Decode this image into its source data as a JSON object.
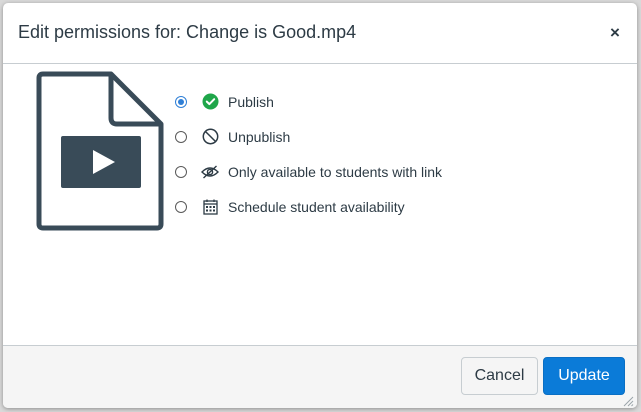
{
  "dialog": {
    "title": "Edit permissions for: Change is Good.mp4",
    "close_symbol": "×",
    "file_icon": "video-file-icon"
  },
  "options": [
    {
      "label": "Publish",
      "icon": "check-circle-icon",
      "checked": true
    },
    {
      "label": "Unpublish",
      "icon": "no-entry-icon",
      "checked": false
    },
    {
      "label": "Only available to students with link",
      "icon": "eye-slash-icon",
      "checked": false
    },
    {
      "label": "Schedule student availability",
      "icon": "calendar-icon",
      "checked": false
    }
  ],
  "footer": {
    "cancel_label": "Cancel",
    "update_label": "Update"
  },
  "colors": {
    "primary": "#0b7bd8",
    "success": "#1fa64a",
    "text": "#2d3b45",
    "icon_dark": "#394b58"
  }
}
